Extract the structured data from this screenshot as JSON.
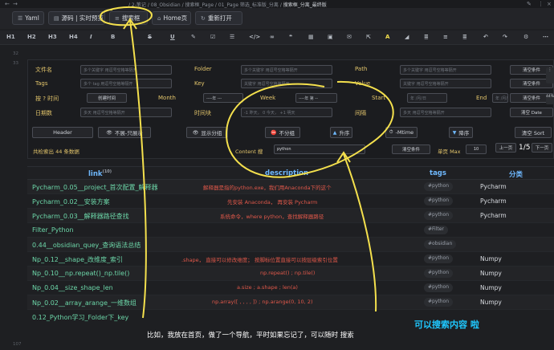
{
  "breadcrumb": {
    "path": "/ 2-笔记 / 08_Obsidian / 搜索框_Page / 01_Page 筛选_标准版_分离 /",
    "current": "搜索框_分离_最终版"
  },
  "toolbar": {
    "yaml": "Yaml",
    "source": "源码 | 实时预览",
    "search": "搜索框",
    "home": "Home页",
    "reopen": "重新打开"
  },
  "format_bar": [
    "H1",
    "H2",
    "H3",
    "H4",
    "I",
    "B",
    "S",
    "U"
  ],
  "line_numbers": {
    "first": "32",
    "second": "33",
    "last": "107"
  },
  "filters": {
    "filename_label": "文件名",
    "filename_placeholder": "多个关键字 用逗号空格等隔开",
    "folder_label": "Folder",
    "folder_placeholder": "多个关键字 用逗号空格等隔开",
    "path_label": "Path",
    "path_placeholder": "多个关键字 用逗号空格等隔开",
    "clear1": "清空条件",
    "tags_label": "Tags",
    "tags_placeholder": "多个 tag 用逗号空格等隔开",
    "key_label": "Key",
    "key_placeholder": "关键字 用逗号空格等隔开",
    "value_label": "Value",
    "value_placeholder": "关键字 用逗号空格等隔开",
    "clear2": "清空条件",
    "by_time_label": "按 ? 时间",
    "created_time": "创建时间",
    "month_label": "Month",
    "month_value": "----年 ---",
    "week_label": "Week",
    "week_value": "----年 第 --",
    "start_label": "Start",
    "start_value": "年 /月/日",
    "end_label": "End",
    "end_value": "年 /月/日",
    "clear3": "清空条件",
    "date_array_label": "日期数",
    "date_array_placeholder": "多天 用逗号空格等隔开",
    "time_block_label": "时间块",
    "time_block_placeholder": "-1 昨天， 0 今天， +1 明天",
    "interval_label": "间隔",
    "interval_placeholder": "多天 用逗号空格等隔开",
    "clear_date": "清空 Date"
  },
  "options": {
    "header": "Header",
    "unfold": "不展-只展示",
    "show_group": "显示分组",
    "no_group": "不分组",
    "asc": "升序",
    "mtime": "-Mtime",
    "sort": "降序",
    "clear_sort": "清空 Sort"
  },
  "summary": {
    "count_text": "共检索出 44 条数据",
    "content_search_label": "Content 搜",
    "content_search_value": "python",
    "clear_content": "清空条件",
    "page_max_label": "单页 Max",
    "page_max_value": "10",
    "prev_page": "上一页",
    "page_indicator": "1/5",
    "next_page": "下一页"
  },
  "table": {
    "headers": {
      "link": "link",
      "link_count": "(10)",
      "description": "description",
      "tags": "tags",
      "category": "分类"
    },
    "rows": [
      {
        "link": "Pycharm_0.05__project_首次配置_解释器",
        "desc": "解释器是指的python.exe，我们用Anaconda下的这个",
        "tag": "#python",
        "cat": "Pycharm"
      },
      {
        "link": "Pycharm_0.02__安装方案",
        "desc": "先安装 Anaconda， 再安装 Pycharm",
        "tag": "#python",
        "cat": "Pycharm"
      },
      {
        "link": "Pycharm_0.03__解释器路径查找",
        "desc": "系统命令，where python，查找解释器路径",
        "tag": "#python",
        "cat": "Pycharm"
      },
      {
        "link": "Filter_Python",
        "desc": "",
        "tag": "#Filter",
        "cat": ""
      },
      {
        "link": "0.44__obsidian_quey_查询语法总结",
        "desc": "",
        "tag": "#obsidian",
        "cat": ""
      },
      {
        "link": "Np_0.12__shape_改维度_索引",
        "desc": ".shape， 直接可以修改维度； 按脚标位置直接可以按层级索引位置",
        "tag": "#python",
        "cat": "Numpy"
      },
      {
        "link": "Np_0.10__np.repeat()_np.tile()",
        "desc": "np.repeat()   ;   np.tile()",
        "tag": "#python",
        "cat": "Numpy"
      },
      {
        "link": "Np_0.04__size_shape_len",
        "desc": "a.size   ;   a.shape   ;   len(a)",
        "tag": "#python",
        "cat": "Numpy"
      },
      {
        "link": "Np_0.02__array_arange_一维数组",
        "desc": "np.array([  ,  ,  ,  ,  ])    ;   np.arange(0, 10, 2)",
        "tag": "#python",
        "cat": "Numpy"
      },
      {
        "link": "0.12_Python学习_Folder下_key",
        "desc": "",
        "tag": "",
        "cat": ""
      }
    ]
  },
  "annotations": {
    "caption_main": "比如，我放在首页，做了一个导航，平时如果忘记了，可以随时 搜索",
    "caption_side": "可以搜索内容 啦"
  },
  "colors": {
    "accent_yellow": "#f4e04d",
    "link_green": "#6cd6a8",
    "header_blue": "#6fb9ff",
    "desc_red": "#e0584a",
    "callout_cyan": "#1fc8ff"
  }
}
